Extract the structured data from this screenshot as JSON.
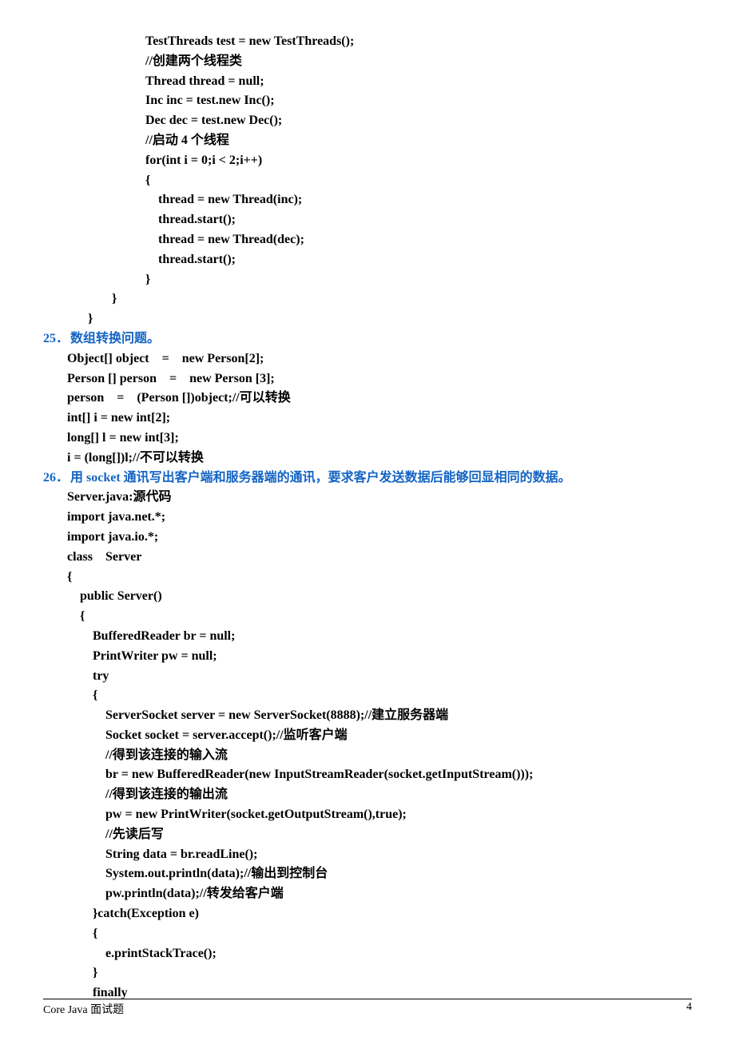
{
  "block1": {
    "l1": "TestThreads test = new TestThreads();",
    "l2": "//创建两个线程类",
    "l3": "Thread thread = null;",
    "l4": "Inc inc = test.new Inc();",
    "l5": "Dec dec = test.new Dec();",
    "l6": "//启动 4 个线程",
    "l7": "for(int i = 0;i < 2;i++)",
    "l8": "{",
    "l9": "    thread = new Thread(inc);",
    "l10": "    thread.start();",
    "l11": "    thread = new Thread(dec);",
    "l12": "    thread.start();",
    "l13": "}",
    "close1": "}",
    "close2": "}"
  },
  "heading25": {
    "num": "25．",
    "text": "数组转换问题。"
  },
  "block25": {
    "l1": "Object[] object    =    new Person[2];",
    "l2": "Person [] person    =    new Person [3];",
    "l3": "person    =    (Person [])object;//可以转换",
    "l4": "int[] i = new int[2];",
    "l5": "long[] l = new int[3];",
    "l6": "i = (long[])l;//不可以转换"
  },
  "heading26": {
    "num": "26．",
    "text": "用 socket 通讯写出客户端和服务器端的通讯，要求客户发送数据后能够回显相同的数据。"
  },
  "block26": {
    "l1": "Server.java:源代码",
    "l2": "import java.net.*;",
    "l3": "import java.io.*;",
    "l4": "",
    "l5": "class    Server",
    "l6": "{",
    "l7": "    public Server()",
    "l8": "    {",
    "l9": "        BufferedReader br = null;",
    "l10": "        PrintWriter pw = null;",
    "l11": "        try",
    "l12": "        {",
    "l13": "            ServerSocket server = new ServerSocket(8888);//建立服务器端",
    "l14": "            Socket socket = server.accept();//监听客户端",
    "l15": "            //得到该连接的输入流",
    "l16": "            br = new BufferedReader(new InputStreamReader(socket.getInputStream()));",
    "l17": "            //得到该连接的输出流",
    "l18": "            pw = new PrintWriter(socket.getOutputStream(),true);",
    "l19": "            //先读后写",
    "l20": "            String data = br.readLine();",
    "l21": "            System.out.println(data);//输出到控制台",
    "l22": "            pw.println(data);//转发给客户端",
    "l23": "        }catch(Exception e)",
    "l24": "        {",
    "l25": "            e.printStackTrace();",
    "l26": "        }",
    "l27": "        finally"
  },
  "footer": {
    "left": "Core Java  面试题",
    "right": "4"
  }
}
